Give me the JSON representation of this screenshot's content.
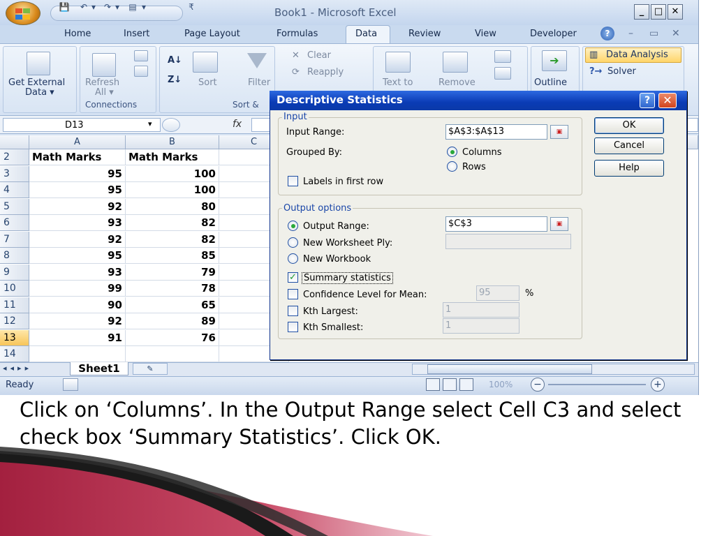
{
  "window": {
    "title": "Book1 - Microsoft Excel",
    "min": "_",
    "restore": "□",
    "close": "✕",
    "quick_access": [
      "💾",
      "↶",
      "▾",
      "↷",
      "▾",
      "▤",
      "▾",
      "₹"
    ]
  },
  "ribbon_tabs": [
    "Home",
    "Insert",
    "Page Layout",
    "Formulas",
    "Data",
    "Review",
    "View",
    "Developer"
  ],
  "active_tab": "Data",
  "ribbon": {
    "get_external_data": [
      "Get External",
      "Data ▾"
    ],
    "refresh": [
      "Refresh",
      "All ▾"
    ],
    "connections_group": "Connections",
    "sort": "Sort",
    "filter": "Filter",
    "sort_group": "Sort &",
    "clear": "Clear",
    "reapply": "Reapply",
    "text_to": "Text to",
    "remove": "Remove",
    "outline": "Outline",
    "data_analysis": "Data Analysis",
    "solver": "Solver"
  },
  "formula_bar": {
    "name_box": "D13",
    "fx": "fx"
  },
  "columns": [
    "A",
    "B",
    "C"
  ],
  "rows": [
    {
      "num": "2",
      "a": "Math Marks",
      "b": "Math Marks"
    },
    {
      "num": "3",
      "a": "95",
      "b": "100"
    },
    {
      "num": "4",
      "a": "95",
      "b": "100"
    },
    {
      "num": "5",
      "a": "92",
      "b": "80"
    },
    {
      "num": "6",
      "a": "93",
      "b": "82"
    },
    {
      "num": "7",
      "a": "92",
      "b": "82"
    },
    {
      "num": "8",
      "a": "95",
      "b": "85"
    },
    {
      "num": "9",
      "a": "93",
      "b": "79"
    },
    {
      "num": "10",
      "a": "99",
      "b": "78"
    },
    {
      "num": "11",
      "a": "90",
      "b": "65"
    },
    {
      "num": "12",
      "a": "92",
      "b": "89"
    },
    {
      "num": "13",
      "a": "91",
      "b": "76"
    },
    {
      "num": "14",
      "a": "",
      "b": ""
    }
  ],
  "sheet_tab": "Sheet1",
  "sheet_nav": "◂◂▸▸",
  "status": {
    "ready": "Ready",
    "zoom": "100%",
    "zoom_out": "−",
    "zoom_in": "+"
  },
  "dialog": {
    "title": "Descriptive Statistics",
    "help": "?",
    "close": "✕",
    "input_group": "Input",
    "input_range_label": "Input Range:",
    "input_range_value": "$A$3:$A$13",
    "grouped_by_label": "Grouped By:",
    "columns_label": "Columns",
    "rows_label": "Rows",
    "labels_first_row": "Labels in first row",
    "output_group": "Output options",
    "output_range_label": "Output Range:",
    "output_range_value": "$C$3",
    "new_worksheet_label": "New Worksheet Ply:",
    "new_workbook_label": "New Workbook",
    "summary_stats_label": "Summary statistics",
    "confidence_label": "Confidence Level for Mean:",
    "confidence_value": "95",
    "percent": "%",
    "kth_largest_label": "Kth Largest:",
    "kth_largest_value": "1",
    "kth_smallest_label": "Kth Smallest:",
    "kth_smallest_value": "1",
    "ok": "OK",
    "cancel": "Cancel",
    "help_btn": "Help"
  },
  "caption": "Click on ‘Columns’. In the Output Range select  Cell C3 and select check box ‘Summary Statistics’. Click OK.",
  "colors": {
    "slide_accent": "#a3203f",
    "dialog_title": "#0a3bb5",
    "ribbon_bg": "#dbe6f4"
  }
}
